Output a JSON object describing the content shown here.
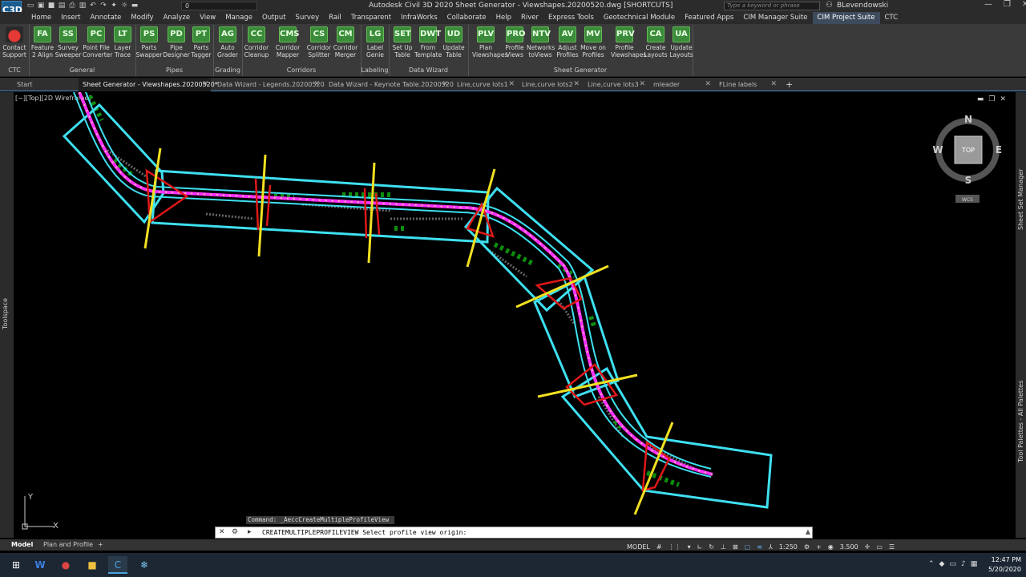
{
  "titlebar": {
    "app_icon": "C3D",
    "layer_value": "0",
    "title": "Autodesk Civil 3D 2020   Sheet Generator - Viewshapes.20200520.dwg [SHORTCUTS]",
    "search_placeholder": "Type a keyword or phrase",
    "user": "BLevendowski"
  },
  "menu": [
    "Home",
    "Insert",
    "Annotate",
    "Modify",
    "Analyze",
    "View",
    "Manage",
    "Output",
    "Survey",
    "Rail",
    "Transparent",
    "InfraWorks",
    "Collaborate",
    "Help",
    "River",
    "Express Tools",
    "Geotechnical Module",
    "Featured Apps",
    "CIM Manager Suite",
    "CIM Project Suite",
    "CTC"
  ],
  "menu_active_index": 19,
  "ribbon": {
    "buttons": [
      {
        "icon": "●",
        "l1": "Contact",
        "l2": "Support",
        "red": true
      },
      {
        "icon": "FA",
        "l1": "Feature",
        "l2": "2 Align"
      },
      {
        "icon": "SS",
        "l1": "Survey",
        "l2": "Sweeper"
      },
      {
        "icon": "PC",
        "l1": "Point File",
        "l2": "Converter"
      },
      {
        "icon": "LT",
        "l1": "Layer",
        "l2": "Trace"
      },
      {
        "icon": "PS",
        "l1": "Parts",
        "l2": "Swapper"
      },
      {
        "icon": "PD",
        "l1": "Pipe",
        "l2": "Designer"
      },
      {
        "icon": "PT",
        "l1": "Parts",
        "l2": "Tagger"
      },
      {
        "icon": "AG",
        "l1": "Auto",
        "l2": "Grader"
      },
      {
        "icon": "CC",
        "l1": "Corridor",
        "l2": "Cleanup"
      },
      {
        "icon": "CMS",
        "l1": "Corridor",
        "l2": "Mapper"
      },
      {
        "icon": "CS",
        "l1": "Corridor",
        "l2": "Splitter"
      },
      {
        "icon": "CM",
        "l1": "Corridor",
        "l2": "Merger"
      },
      {
        "icon": "LG",
        "l1": "Label",
        "l2": "Genie"
      },
      {
        "icon": "SET",
        "l1": "Set Up",
        "l2": "Table"
      },
      {
        "icon": "DWT",
        "l1": "From",
        "l2": "Template"
      },
      {
        "icon": "UD",
        "l1": "Update",
        "l2": "Table"
      },
      {
        "icon": "PLV",
        "l1": "Plan",
        "l2": "Viewshapes"
      },
      {
        "icon": "PRO",
        "l1": "Profile",
        "l2": "Views"
      },
      {
        "icon": "NTV",
        "l1": "Networks",
        "l2": "toViews"
      },
      {
        "icon": "AV",
        "l1": "Adjust",
        "l2": "Profiles"
      },
      {
        "icon": "MV",
        "l1": "Move on",
        "l2": "Profiles"
      },
      {
        "icon": "PRV",
        "l1": "Profile",
        "l2": "Viewshapes"
      },
      {
        "icon": "CA",
        "l1": "Create",
        "l2": "Layouts"
      },
      {
        "icon": "UA",
        "l1": "Update",
        "l2": "Layouts"
      }
    ],
    "panels": [
      "CTC",
      "General",
      "Pipes",
      "Grading",
      "Corridors",
      "Labeling",
      "Data Wizard",
      "Sheet Generator"
    ]
  },
  "file_tabs": [
    {
      "label": "Start",
      "active": false,
      "closable": false
    },
    {
      "label": "Sheet Generator - Viewshapes.20200520*",
      "active": true,
      "closable": true
    },
    {
      "label": "Data Wizard - Legends.20200520",
      "active": false,
      "closable": true
    },
    {
      "label": "Data Wizard - Keynote Table.20200520",
      "active": false,
      "closable": true
    },
    {
      "label": "Line,curve lots1",
      "active": false,
      "closable": true
    },
    {
      "label": "Line,curve lots2",
      "active": false,
      "closable": true
    },
    {
      "label": "Line,curve lots3",
      "active": false,
      "closable": true
    },
    {
      "label": "mleader",
      "active": false,
      "closable": true
    },
    {
      "label": "FLine labels",
      "active": false,
      "closable": true
    }
  ],
  "viewport": {
    "label": "[−][Top][2D Wireframe]",
    "viewcube": {
      "n": "N",
      "s": "S",
      "e": "E",
      "w": "W",
      "face": "TOP",
      "ucs": "WCS"
    },
    "ucs_x": "X",
    "ucs_y": "Y"
  },
  "palettes": {
    "left": "Toolspace",
    "right_top": "Sheet Set Manager",
    "right_bottom": "Tool Palettes - All Palettes"
  },
  "command": {
    "history": "Command:  _AeccCreateMultipleProfileView",
    "prompt": "CREATEMULTIPLEPROFILEVIEW Select profile view origin:"
  },
  "layout_tabs": [
    "Model",
    "Plan and Profile"
  ],
  "status": {
    "model": "MODEL",
    "scale": "1:250",
    "value": "3.500"
  },
  "clock": {
    "time": "12:47 PM",
    "date": "5/20/2020"
  },
  "colors": {
    "viewframe": "#3ee0f0",
    "alignment": "#ff30ff",
    "matchline": "#f0e020",
    "breakline": "#e01818",
    "tree": "#0e8f0e"
  }
}
